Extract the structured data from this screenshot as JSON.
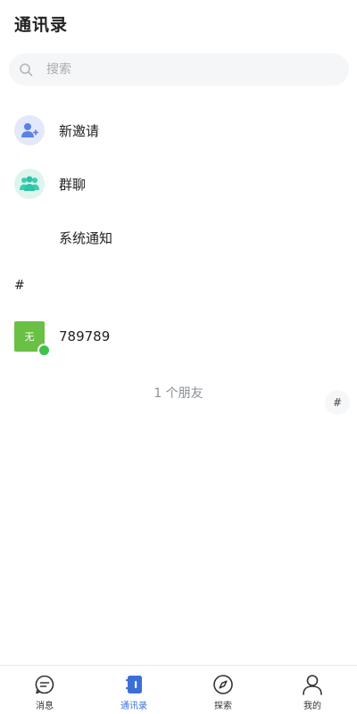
{
  "header": {
    "title": "通讯录"
  },
  "search": {
    "placeholder": "搜索",
    "icon": "search-icon"
  },
  "menu": [
    {
      "label": "新邀请",
      "icon": "add-user-icon",
      "bg": "#e3e9fb",
      "color": "#4f78e0"
    },
    {
      "label": "群聊",
      "icon": "group-icon",
      "bg": "#ddf5ee",
      "color": "#3ccdb0"
    },
    {
      "label": "系统通知"
    }
  ],
  "sections": [
    {
      "letter": "#",
      "contacts": [
        {
          "avatar_text": "无",
          "name": "789789",
          "status": "online",
          "avatar_color": "#6abf45"
        }
      ]
    }
  ],
  "footer": {
    "friend_count": "1 个朋友"
  },
  "index_bar": [
    "#"
  ],
  "tabbar": {
    "active": "contacts",
    "items": [
      {
        "key": "messages",
        "label": "消息",
        "icon": "chat-icon"
      },
      {
        "key": "contacts",
        "label": "通讯录",
        "icon": "contacts-book-icon"
      },
      {
        "key": "explore",
        "label": "探索",
        "icon": "compass-icon"
      },
      {
        "key": "me",
        "label": "我的",
        "icon": "person-icon"
      }
    ]
  },
  "colors": {
    "accent": "#3b6fd8",
    "online": "#3ec24a"
  }
}
